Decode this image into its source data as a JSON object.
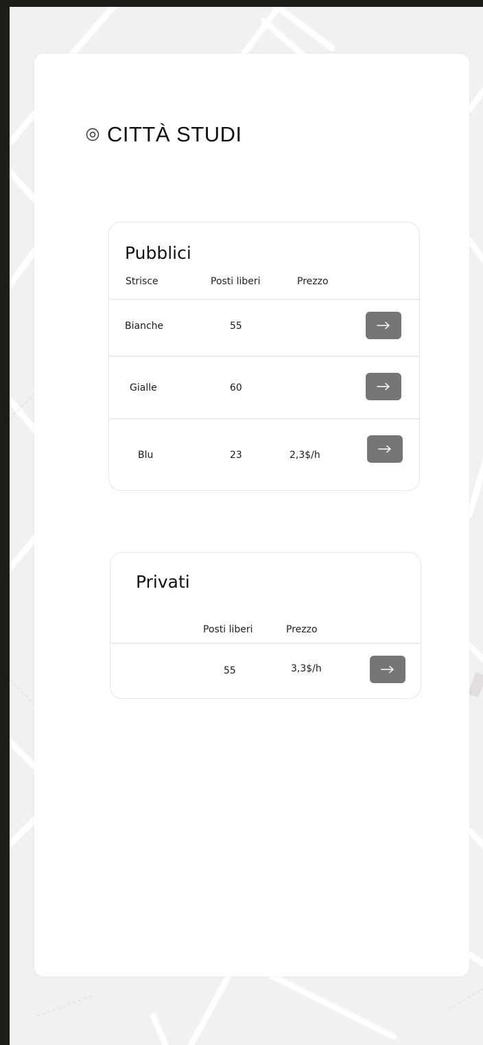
{
  "location": {
    "icon": "location-pin-icon",
    "title": "CITTÀ STUDI"
  },
  "public": {
    "title": "Pubblici",
    "headers": {
      "type": "Strisce",
      "spots": "Posti liberi",
      "price": "Prezzo"
    },
    "rows": [
      {
        "type": "Bianche",
        "spots": "55",
        "price": "",
        "action_icon": "arrow-right-icon"
      },
      {
        "type": "Gialle",
        "spots": "60",
        "price": "",
        "action_icon": "arrow-right-icon"
      },
      {
        "type": "Blu",
        "spots": "23",
        "price": "2,3$/h",
        "action_icon": "arrow-right-icon"
      }
    ]
  },
  "private": {
    "title": "Privati",
    "headers": {
      "spots": "Posti liberi",
      "price": "Prezzo"
    },
    "rows": [
      {
        "spots": "55",
        "price": "3,3$/h",
        "action_icon": "arrow-right-icon"
      }
    ]
  },
  "colors": {
    "outer_bg": "#1c1d19",
    "map_bg": "#f1f1f1",
    "panel_bg": "#ffffff",
    "button_bg": "#767676"
  }
}
